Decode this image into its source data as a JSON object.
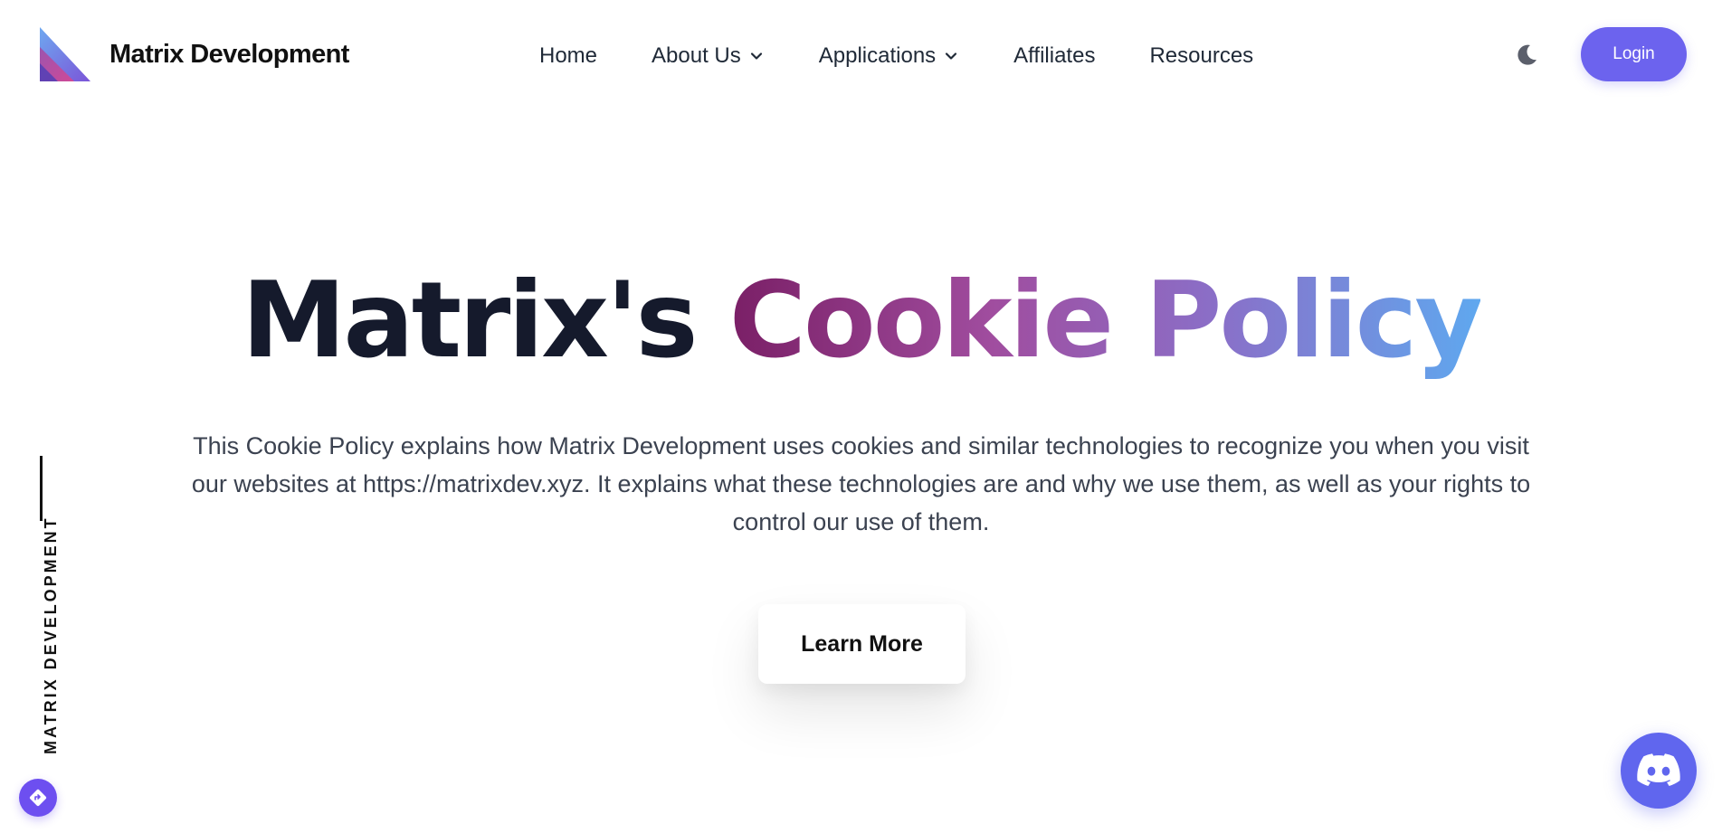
{
  "brand": {
    "name": "Matrix Development"
  },
  "nav": {
    "home": "Home",
    "about": "About Us",
    "applications": "Applications",
    "affiliates": "Affiliates",
    "resources": "Resources"
  },
  "header": {
    "login_label": "Login",
    "theme_icon": "moon-icon"
  },
  "hero": {
    "title_dark": "Matrix's ",
    "title_gradient": "Cookie Policy",
    "description": "This Cookie Policy explains how Matrix Development uses cookies and similar technologies to recognize you when you visit our websites at https://matrixdev.xyz. It explains what these technologies are and why we use them, as well as your rights to control our use of them.",
    "cta_label": "Learn More"
  },
  "side": {
    "vertical_label": "MATRIX DEVELOPMENT"
  },
  "colors": {
    "accent": "#6c63ee",
    "discord": "#6066ee",
    "gradient_start": "#7a1f66",
    "gradient_end": "#5fa8ef"
  }
}
